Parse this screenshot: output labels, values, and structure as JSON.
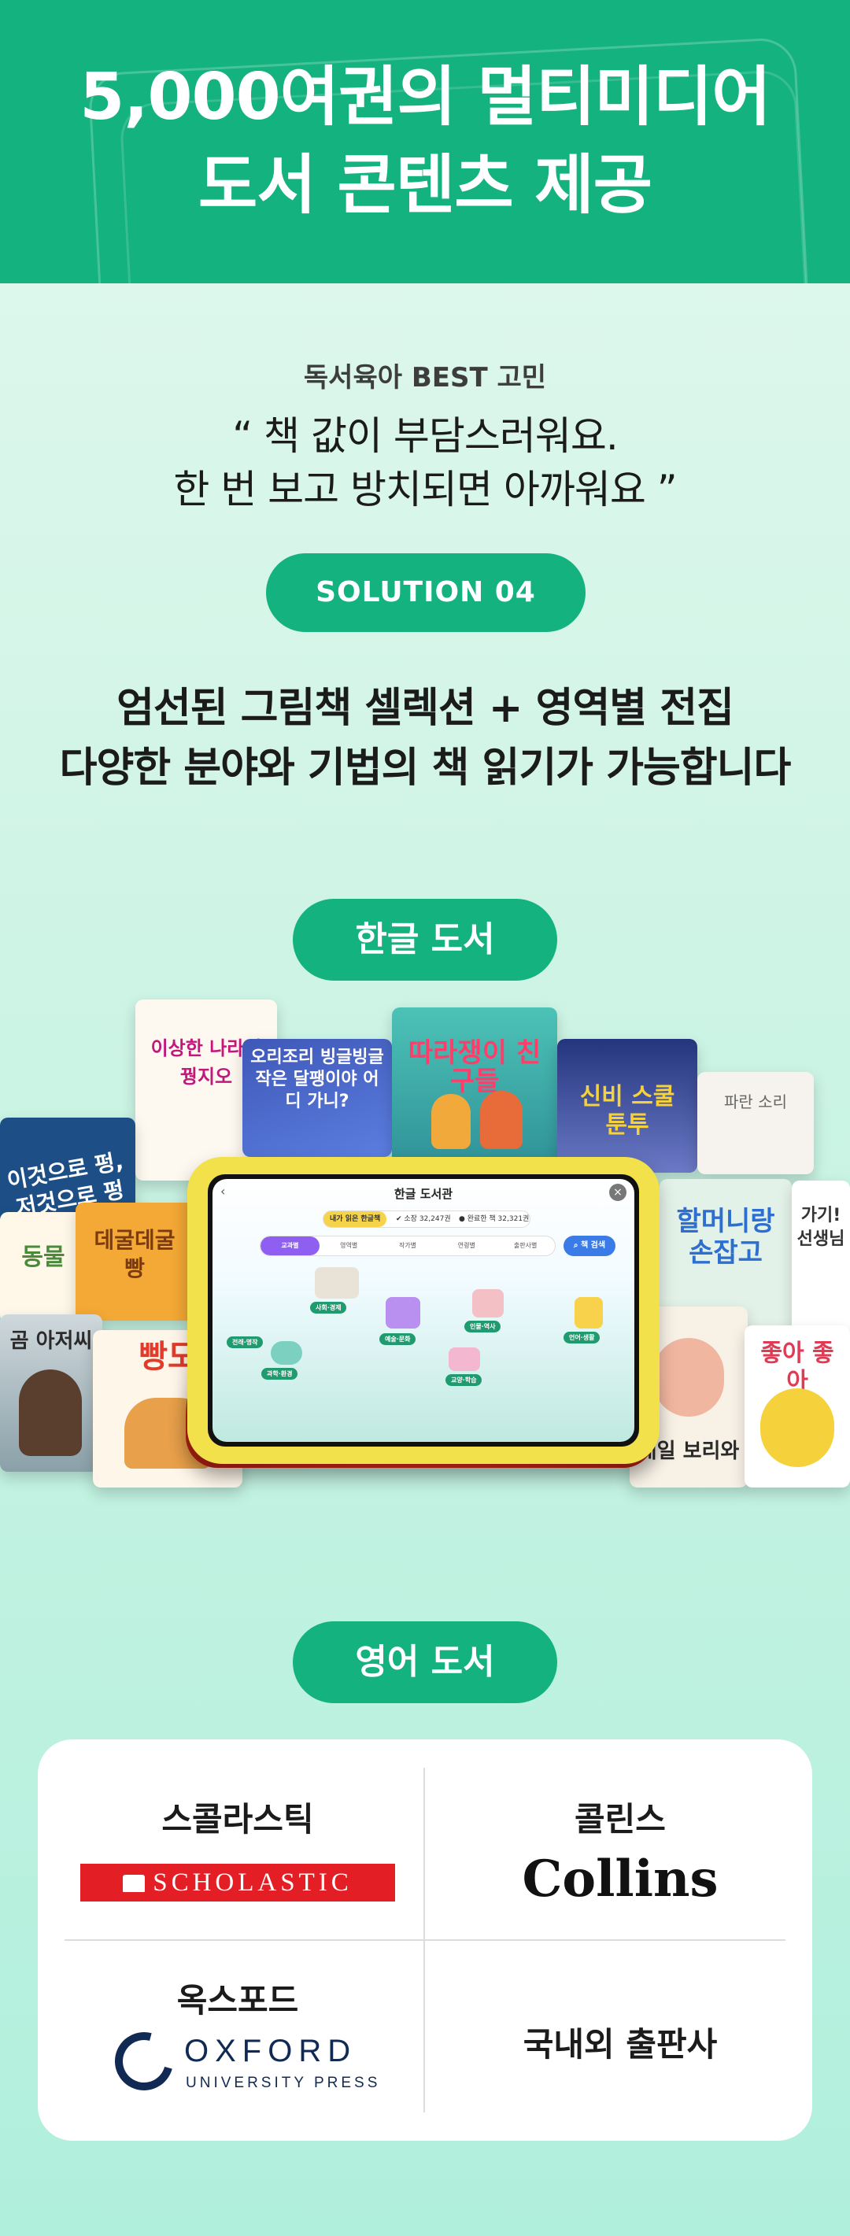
{
  "header": {
    "title": "5,000여권의 멀티미디어\n도서 콘텐츠 제공"
  },
  "subhead": "독서육아 BEST 고민",
  "quote": "“ 책 값이 부담스러워요.\n한 번 보고 방치되면 아까워요 ”",
  "solution_label": "SOLUTION   04",
  "description": "엄선된 그림책 셀렉션 + 영역별 전집\n다양한 분야와 기법의 책 읽기가 가능합니다",
  "korean_books": {
    "label": "한글 도서",
    "covers": [
      "이것으로 펑, 저것으로 펑",
      "동물",
      "데굴데굴 빵",
      "곰 아저씨",
      "빵도",
      "이상한 나라의 꿩지오",
      "오리조리 빙글빙글 작은 달팽이야 어디 가니?",
      "따라쟁이 친구들",
      "신비 스쿨 툰투",
      "파란 소리",
      "할머니랑 손잡고",
      "가기! 선생님",
      "매일 보리와",
      "좋아 좋아"
    ]
  },
  "tablet_app": {
    "title": "한글 도서관",
    "back": "‹",
    "close": "×",
    "stat_label": "내가 읽은 한글책",
    "stat_1": "✔ 소장 32,247권",
    "stat_2": "● 완료한 책 32,321권",
    "tabs": [
      "교과별",
      "영역별",
      "작가별",
      "연령별",
      "출판사별"
    ],
    "search": "책 검색",
    "zones": [
      "사회·경제",
      "인물·역사",
      "언어·생활",
      "전래·명작",
      "예술·문화",
      "과학·환경",
      "교양·학습"
    ]
  },
  "english_books": {
    "label": "영어 도서"
  },
  "publishers": [
    {
      "name": "스콜라스틱",
      "logo": "SCHOLASTIC"
    },
    {
      "name": "콜린스",
      "logo": "Collins"
    },
    {
      "name": "옥스포드",
      "logo": "OXFORD",
      "logo_sub": "UNIVERSITY PRESS"
    },
    {
      "name": "국내외 출판사"
    }
  ],
  "colors": {
    "brand_green": "#14b27e",
    "scholastic_red": "#e31e25",
    "oxford_navy": "#112a54"
  }
}
